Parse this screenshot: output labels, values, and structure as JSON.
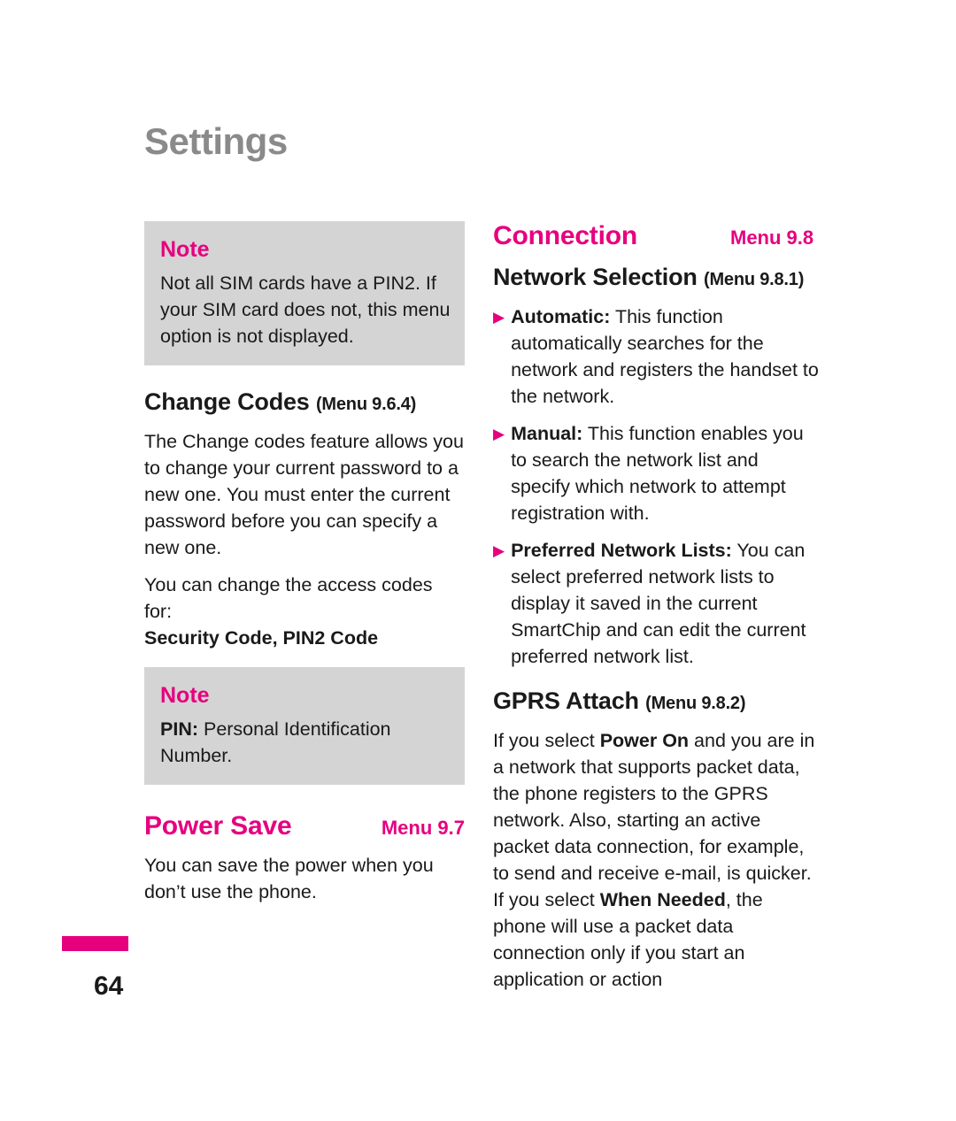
{
  "page": {
    "title": "Settings",
    "number": "64"
  },
  "left_column": {
    "note1": {
      "label": "Note",
      "text": "Not all SIM cards have a PIN2. If your SIM card does not, this menu option is not displayed."
    },
    "change_codes": {
      "heading": "Change Codes",
      "menu_ref": "(Menu 9.6.4)",
      "para1": "The Change codes feature allows you to change your current password to a new one. You must enter the current password before you can specify a new one.",
      "para2": "You can change the access codes for:",
      "para3_bold": "Security Code, PIN2 Code"
    },
    "note2": {
      "label": "Note",
      "text_bold": "PIN:",
      "text": " Personal Identification Number."
    },
    "power_save": {
      "heading": "Power Save",
      "menu": "Menu 9.7",
      "para1": "You can save the power when you don’t use the phone."
    }
  },
  "right_column": {
    "connection": {
      "heading": "Connection",
      "menu": "Menu 9.8"
    },
    "network_selection": {
      "heading": "Network Selection",
      "menu_ref": "(Menu 9.8.1)",
      "bullets": [
        {
          "bold": "Automatic:",
          "text": " This function automatically searches for the network and registers the handset to the network."
        },
        {
          "bold": "Manual:",
          "text": " This function enables you to search the network list and specify which network to attempt registration with."
        },
        {
          "bold": "Preferred Network Lists:",
          "text": " You can select preferred network lists to display it saved in the current SmartChip and can edit the current preferred network list."
        }
      ]
    },
    "gprs_attach": {
      "heading": "GPRS Attach",
      "menu_ref": "(Menu 9.8.2)",
      "para_1": "If you select ",
      "para_bold_1": "Power On",
      "para_2": " and you are in a network that supports packet data, the phone registers to the GPRS network. Also, starting an active packet data connection, for example, to send and receive e-mail, is quicker. If you select ",
      "para_bold_2": "When Needed",
      "para_3": ", the phone will use a packet data connection only if you start an application or action"
    }
  },
  "colors": {
    "accent": "#e6007e",
    "note_bg": "#d4d4d4",
    "title_gray": "#8a8a8a"
  }
}
